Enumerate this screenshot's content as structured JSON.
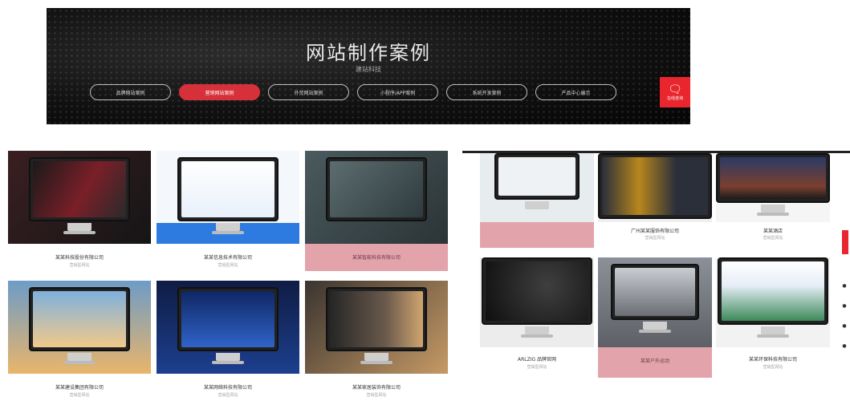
{
  "banner": {
    "title": "网站制作案例",
    "subtitle": "建站科技",
    "tabs": [
      {
        "label": "品牌网站案例",
        "active": false
      },
      {
        "label": "营销网站案例",
        "active": true
      },
      {
        "label": "外贸网站案例",
        "active": false
      },
      {
        "label": "小程序/APP案例",
        "active": false
      },
      {
        "label": "系统开发案例",
        "active": false
      },
      {
        "label": "产品中心展示",
        "active": false
      }
    ],
    "chat": {
      "icon": "chat-bubble-icon",
      "label": "在线咨询"
    },
    "accent": "#e9252e"
  },
  "left_grid": {
    "cards": [
      {
        "caption": "某某科技股份有限公司",
        "sub": "营销型网站",
        "highlight": false
      },
      {
        "caption": "某某信息技术有限公司",
        "sub": "营销型网站",
        "highlight": false
      },
      {
        "caption": "某某智能科技有限公司",
        "sub": "营销型网站",
        "highlight": true
      },
      {
        "caption": "某某建设集团有限公司",
        "sub": "营销型网站",
        "highlight": false
      },
      {
        "caption": "某某网络科技有限公司",
        "sub": "营销型网站",
        "highlight": false
      },
      {
        "caption": "某某家居装饰有限公司",
        "sub": "营销型网站",
        "highlight": false
      }
    ]
  },
  "right_grid": {
    "cards": [
      {
        "caption": "",
        "sub": "",
        "highlight": true
      },
      {
        "caption": "广州某某服饰有限公司",
        "sub": "营销型网站",
        "highlight": false
      },
      {
        "caption": "某某酒店",
        "sub": "营销型网站",
        "highlight": false
      },
      {
        "caption": "ARLZIG 品牌官网",
        "sub": "营销型网站",
        "highlight": false
      },
      {
        "caption": "某某户外运动",
        "sub": "营销型网站",
        "highlight": true
      },
      {
        "caption": "某某环保科技有限公司",
        "sub": "营销型网站",
        "highlight": false
      }
    ]
  }
}
